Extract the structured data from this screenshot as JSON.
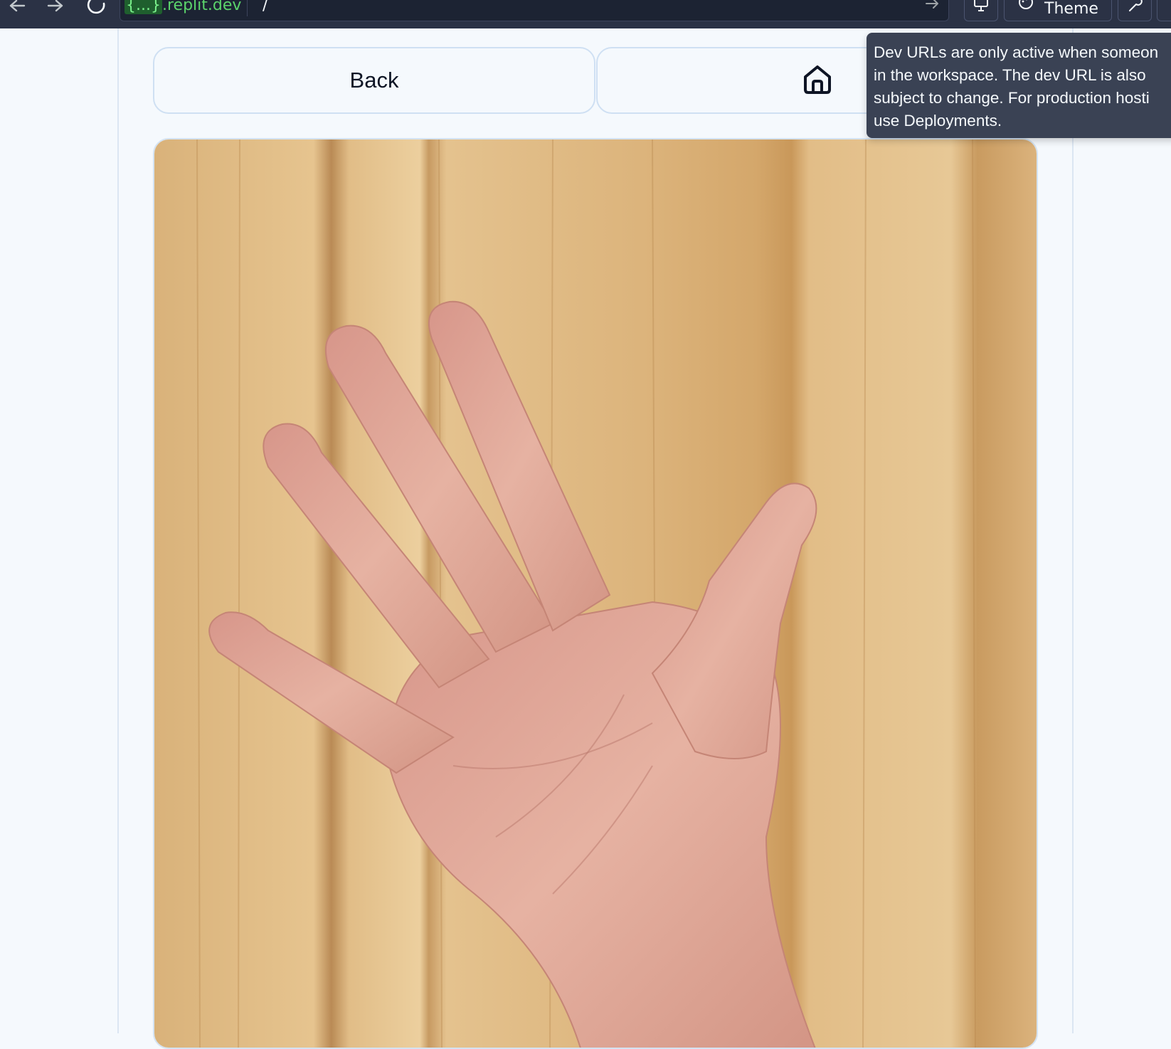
{
  "browser": {
    "url_host_braces": "{...}",
    "url_host_suffix": ".replit.dev",
    "url_path": "/",
    "theme_label": "Theme"
  },
  "icons": {
    "back": "arrow-left-icon",
    "forward": "arrow-right-icon",
    "reload": "reload-icon",
    "go": "arrow-right-icon",
    "devices": "monitor-icon",
    "theme": "palette-icon",
    "tools": "wrench-icon",
    "home": "home-icon"
  },
  "page": {
    "back_label": "Back",
    "image_subject": "hand-photo"
  },
  "tooltip": {
    "text": "Dev URLs are only active when someon\nin the workspace. The dev URL is also\nsubject to change. For production hosti\nuse Deployments."
  },
  "colors": {
    "topbar": "#2b3245",
    "page_bg": "#f5f9fd",
    "url_green": "#5bd36b",
    "tooltip_bg": "#3a4254"
  }
}
